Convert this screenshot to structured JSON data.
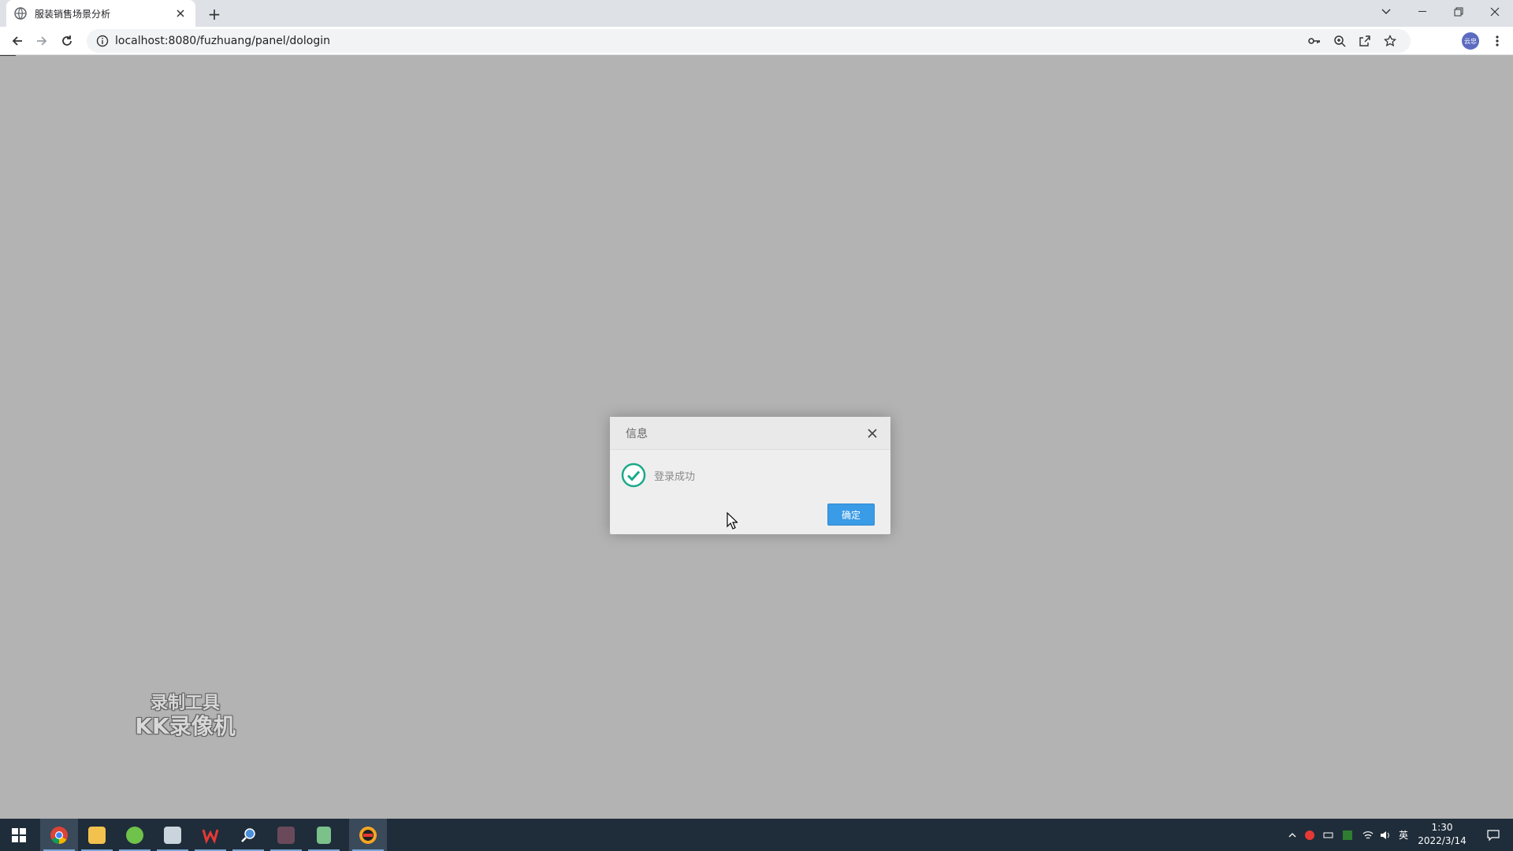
{
  "browser": {
    "tab_title": "服装销售场景分析",
    "new_tab_label": "+",
    "url": "localhost:8080/fuzhuang/panel/dologin",
    "profile_label": "云忠"
  },
  "dialog": {
    "title": "信息",
    "message": "登录成功",
    "ok_label": "确定"
  },
  "watermark": {
    "line1": "录制工具",
    "line2": "KK录像机"
  },
  "taskbar": {
    "ime": "英",
    "time": "1:30",
    "date": "2022/3/14"
  },
  "colors": {
    "overlay_bg": "#b3b3b3",
    "dialog_button": "#3a9be6",
    "success_green": "#1aaa8a",
    "taskbar_bg": "#1f2d3a"
  },
  "icons": {
    "tab_favicon": "globe-icon",
    "success": "check-circle-icon",
    "close": "close-icon"
  }
}
